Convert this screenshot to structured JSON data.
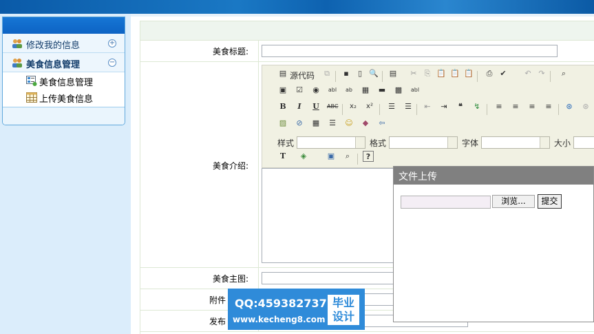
{
  "sidebar": {
    "menus": [
      {
        "label": "修改我的信息",
        "toggle": "+"
      },
      {
        "label": "美食信息管理",
        "toggle": "−"
      }
    ],
    "sub_items": [
      {
        "label": "美食信息管理"
      },
      {
        "label": "上传美食信息"
      }
    ]
  },
  "form": {
    "title_label": "美食标题:",
    "intro_label": "美食介绍:",
    "image_label": "美食主图:",
    "attach_label": "附件",
    "publish_label": "发布"
  },
  "editor": {
    "source_label": "源代码",
    "style_label": "样式",
    "format_label": "格式",
    "font_label": "字体",
    "size_label": "大小"
  },
  "upload_dialog": {
    "title": "文件上传",
    "browse_label": "浏览...",
    "submit_label": "提交"
  },
  "watermark": {
    "qq": "QQ:459382737",
    "url": "www.kecheng8.com",
    "badge_line1": "毕业",
    "badge_line2": "设计"
  }
}
